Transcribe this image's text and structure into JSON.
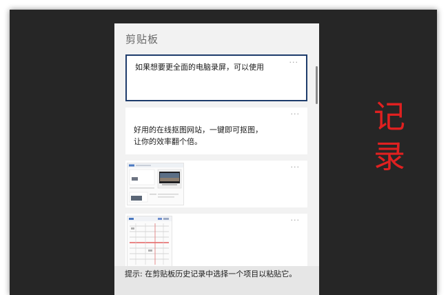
{
  "panel": {
    "title": "剪贴板",
    "items": [
      {
        "kind": "text",
        "text": "如果想要更全面的电脑录屏，可以使用",
        "selected": true,
        "more": "···"
      },
      {
        "kind": "text",
        "text": "好用的在线抠图网站，一键即可抠图，\n让你的效率翻个倍。",
        "selected": false,
        "more": "···"
      },
      {
        "kind": "image",
        "more": "···",
        "thumb": "screenshot-thumbnail"
      },
      {
        "kind": "image",
        "more": "···",
        "thumb": "document-thumbnail"
      }
    ],
    "hint": "提示: 在剪贴板历史记录中选择一个项目以粘贴它。"
  },
  "annotation": {
    "text": "记录",
    "color": "#e02020"
  },
  "colors": {
    "backdrop": "#262626",
    "panel": "#f2f2f2",
    "selected_border": "#1d3b6b",
    "hint_bg": "#e6e6e6"
  }
}
